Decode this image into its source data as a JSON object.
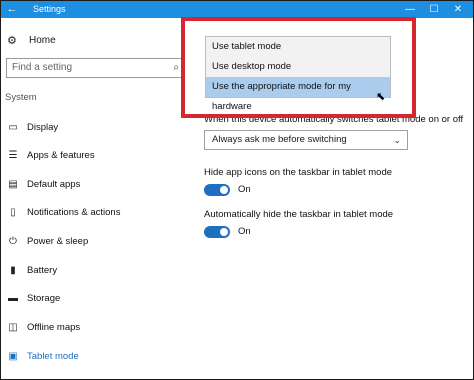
{
  "window": {
    "title": "Settings",
    "back_glyph": "←",
    "minimize_glyph": "—",
    "maximize_glyph": "☐",
    "close_glyph": "✕",
    "titlebar_color": "#1e8fe0"
  },
  "sidebar": {
    "home_label": "Home",
    "search_placeholder": "Find a setting",
    "section_label": "System",
    "items": [
      {
        "label": "Display",
        "icon": "display-icon"
      },
      {
        "label": "Apps & features",
        "icon": "apps-list-icon"
      },
      {
        "label": "Default apps",
        "icon": "default-apps-icon"
      },
      {
        "label": "Notifications & actions",
        "icon": "notifications-icon"
      },
      {
        "label": "Power & sleep",
        "icon": "power-icon"
      },
      {
        "label": "Battery",
        "icon": "battery-icon"
      },
      {
        "label": "Storage",
        "icon": "storage-icon"
      },
      {
        "label": "Offline maps",
        "icon": "map-icon"
      },
      {
        "label": "Tablet mode",
        "icon": "tablet-icon",
        "active": true
      }
    ]
  },
  "main": {
    "switch_setting_label": "When this device automatically switches tablet mode on or off",
    "switch_setting_value": "Always ask me before switching",
    "hide_icons_label": "Hide app icons on the taskbar in tablet mode",
    "hide_icons_state": "On",
    "hide_taskbar_label": "Automatically hide the taskbar in tablet mode",
    "hide_taskbar_state": "On"
  },
  "dropdown": {
    "options": [
      "Use tablet mode",
      "Use desktop mode",
      "Use the appropriate mode for my hardware"
    ],
    "selected_index": 2,
    "selected_color": "#aacdee"
  },
  "annotation": {
    "highlight_color": "#d6262f"
  },
  "accent_color": "#1e6fc0"
}
